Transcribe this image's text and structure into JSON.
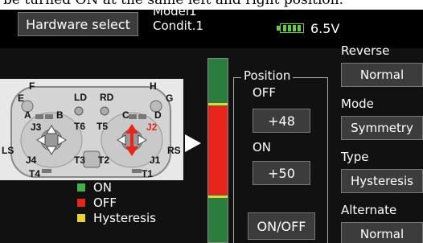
{
  "document": {
    "caption_fragment": "be turned ON at the same left and right position."
  },
  "header": {
    "hardware_select_label": "Hardware select",
    "model_name": "Model1",
    "condition": "Condit.1",
    "battery_voltage": "6.5V",
    "battery_icon": "battery-icon"
  },
  "transmitter": {
    "labels": {
      "F": "F",
      "H": "H",
      "E": "E",
      "G": "G",
      "LD": "LD",
      "RD": "RD",
      "A": "A",
      "B": "B",
      "C": "C",
      "D": "D",
      "J3": "J3",
      "J2": "J2",
      "T6": "T6",
      "T5": "T5",
      "LS": "LS",
      "RS": "RS",
      "J4": "J4",
      "J1": "J1",
      "T3": "T3",
      "T2": "T2",
      "T4": "T4",
      "T1": "T1"
    },
    "selected_stick": "J2"
  },
  "legend": {
    "items": [
      {
        "label": "ON",
        "color": "#43b049"
      },
      {
        "label": "OFF",
        "color": "#e8251c"
      },
      {
        "label": "Hysteresis",
        "color": "#e5d23a"
      }
    ]
  },
  "meter": {
    "colors": {
      "on": "#2a7d3c",
      "off": "#e8251c",
      "hysteresis": "#e5d23a"
    },
    "off_range": [
      -48,
      48
    ],
    "hysteresis_lines": [
      50,
      -50
    ]
  },
  "position": {
    "title": "Position",
    "off_label": "OFF",
    "off_value": "+48",
    "on_label": "ON",
    "on_value": "+50",
    "mode_button": "ON/OFF"
  },
  "settings": {
    "reverse": {
      "label": "Reverse",
      "value": "Normal"
    },
    "mode": {
      "label": "Mode",
      "value": "Symmetry"
    },
    "type": {
      "label": "Type",
      "value": "Hysteresis"
    },
    "alternate": {
      "label": "Alternate",
      "value": "Normal"
    }
  }
}
